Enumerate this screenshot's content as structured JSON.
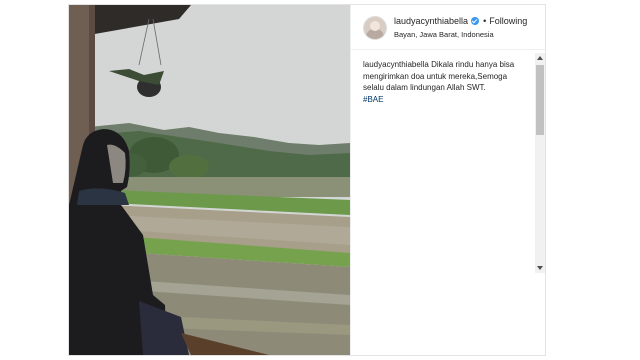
{
  "post": {
    "username": "laudyacynthiabella",
    "follow_label": "Following",
    "location": "Bayan, Jawa Barat, Indonesia",
    "caption_user": "laudyacynthiabella",
    "caption_text": "Dikala rindu hanya bisa mengirimkan doa untuk mereka,Semoga selalu dalam lindungan Allah SWT.",
    "hashtag": "#BAE"
  },
  "icons": {
    "verified": "verified-badge-icon",
    "avatar": "profile-avatar"
  },
  "colors": {
    "verified": "#3897f0",
    "hashtag": "#003569",
    "text": "#262626"
  }
}
